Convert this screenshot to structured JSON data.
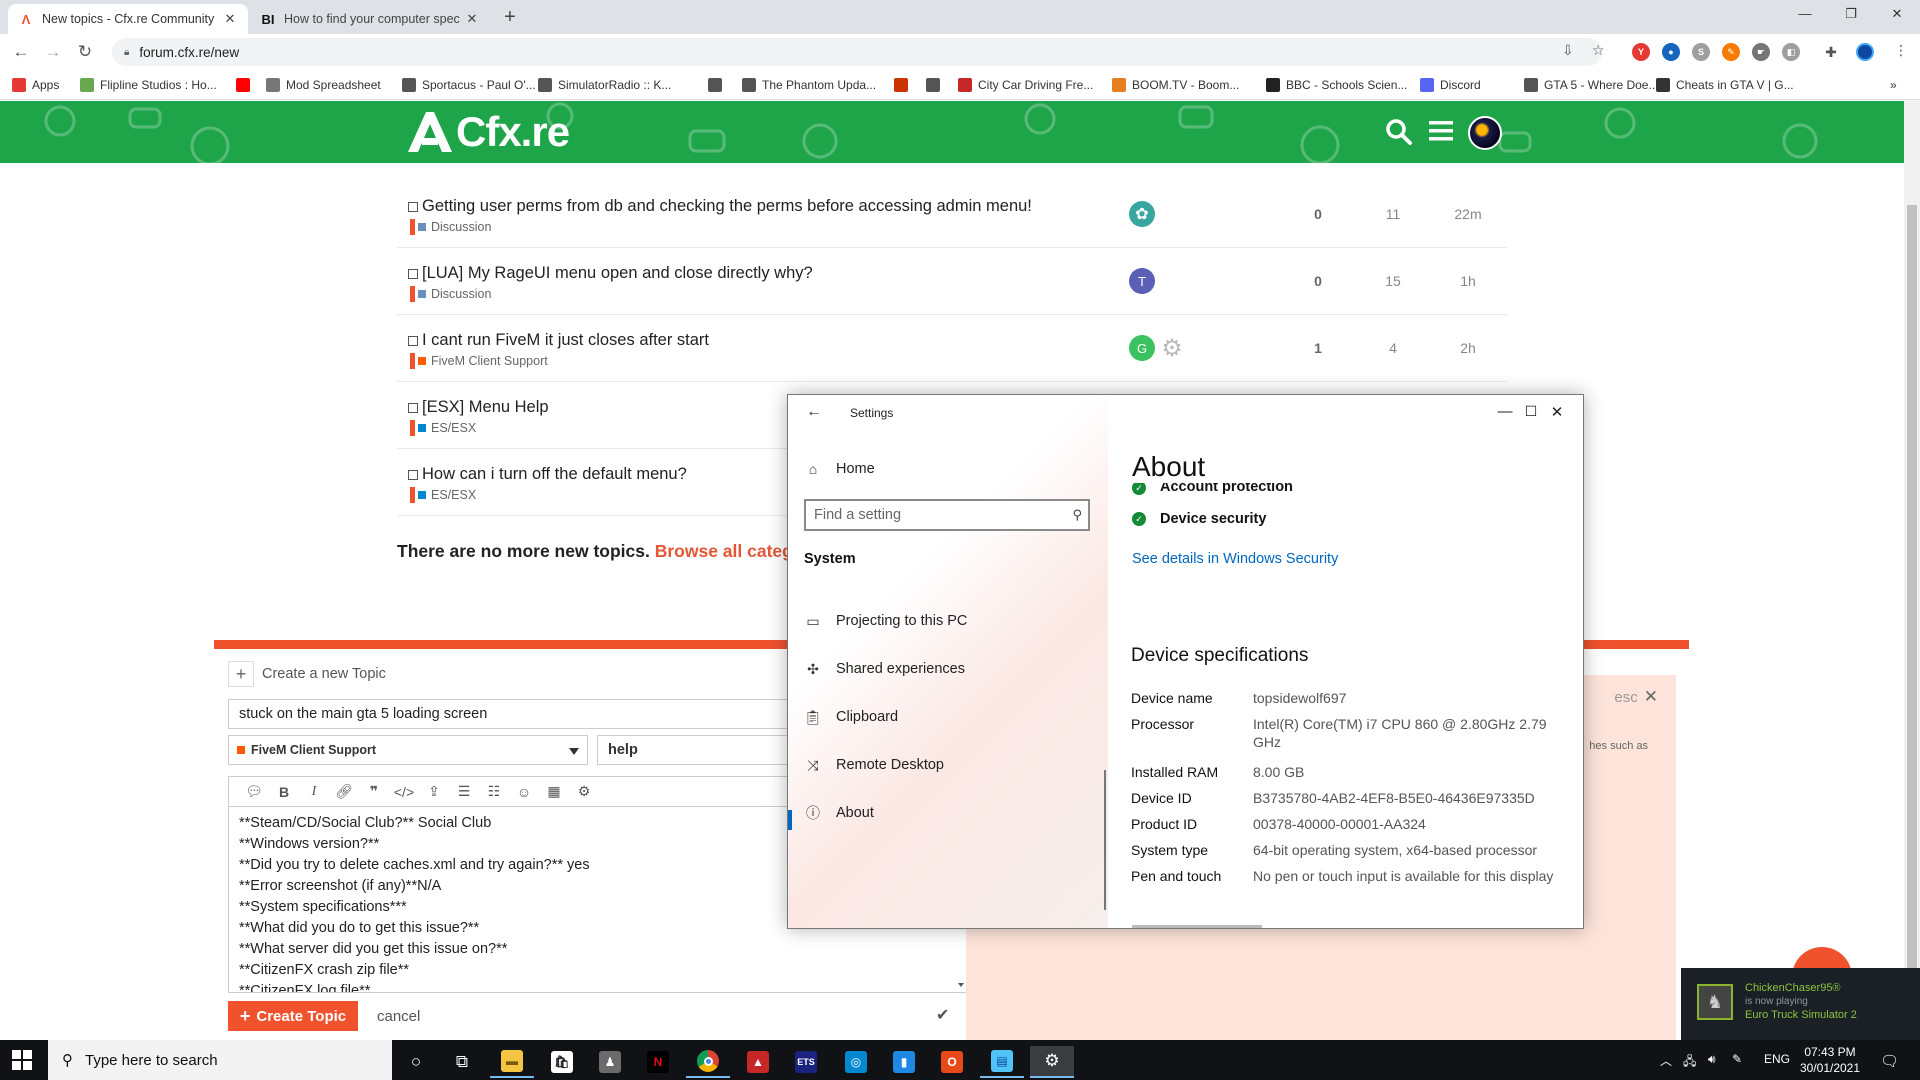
{
  "browser": {
    "tabs": [
      {
        "title": "New topics - Cfx.re Community",
        "favicon": "cfx-logo-icon"
      },
      {
        "title": "How to find your computer spec",
        "favicon_text": "BI"
      }
    ],
    "url": "forum.cfx.re/new",
    "bookmarks": [
      {
        "label": "Apps",
        "icon": "apps-grid-icon",
        "color": "#e53935"
      },
      {
        "label": "Flipline Studios : Ho...",
        "color": "#6aa84f"
      },
      {
        "label": "",
        "icon": "youtube-icon",
        "color": "#ff0000"
      },
      {
        "label": "Mod Spreadsheet",
        "color": "#777777"
      },
      {
        "label": "Sportacus - Paul O'...",
        "color": "#555555"
      },
      {
        "label": "SimulatorRadio :: K...",
        "color": "#555555"
      },
      {
        "label": "",
        "color": "#555555"
      },
      {
        "label": "The Phantom Upda...",
        "color": "#555555"
      },
      {
        "label": "",
        "color": "#cc3300"
      },
      {
        "label": "",
        "color": "#555555"
      },
      {
        "label": "City Car Driving Fre...",
        "color": "#c62828"
      },
      {
        "label": "BOOM.TV - Boom...",
        "color": "#e67e22"
      },
      {
        "label": "BBC - Schools Scien...",
        "color": "#222222"
      },
      {
        "label": "Discord",
        "color": "#5865f2"
      },
      {
        "label": "GTA 5 - Where Doe...",
        "color": "#555555"
      },
      {
        "label": "Cheats in GTA V | G...",
        "color": "#333333"
      }
    ]
  },
  "forum": {
    "topics": [
      {
        "title": "Getting user perms from db and checking the perms before accessing admin menu!",
        "category": "Discussion",
        "cat_color": "#6c8ebf",
        "cat_bar": "#f0522e",
        "poster_letter": "",
        "poster_color": "#3aa6a0",
        "replies": "0",
        "views": "11",
        "activity": "22m",
        "extra_poster": false
      },
      {
        "title": "[LUA] My RageUI menu open and close directly why?",
        "category": "Discussion",
        "cat_color": "#6c8ebf",
        "cat_bar": "#f0522e",
        "poster_letter": "T",
        "poster_color": "#5b5fb5",
        "replies": "0",
        "views": "15",
        "activity": "1h",
        "extra_poster": false
      },
      {
        "title": "I cant run FiveM it just closes after start",
        "category": "FiveM Client Support",
        "cat_color": "#ff5c00",
        "cat_bar": "#f0522e",
        "poster_letter": "G",
        "poster_color": "#3bc160",
        "replies": "1",
        "views": "4",
        "activity": "2h",
        "extra_poster": true
      },
      {
        "title": "[ESX] Menu Help",
        "category": "ES/ESX",
        "cat_color": "#0088cc",
        "cat_bar": "#f0522e",
        "poster_letter": "",
        "poster_color": "",
        "replies": "",
        "views": "",
        "activity": "",
        "extra_poster": false
      },
      {
        "title": "How can i turn off the default menu?",
        "category": "ES/ESX",
        "cat_color": "#0088cc",
        "cat_bar": "#f0522e",
        "poster_letter": "",
        "poster_color": "",
        "replies": "",
        "views": "",
        "activity": "",
        "extra_poster": false
      }
    ],
    "no_more_text": "There are no more new topics. ",
    "browse_link": "Browse all categ"
  },
  "composer": {
    "action_label": "Create a new Topic",
    "title_value": "stuck on the main gta 5 loading screen",
    "category": "FiveM Client Support",
    "tag_value": "help",
    "body_lines": [
      "**Steam/CD/Social Club?** Social Club",
      "**Windows version?**",
      "**Did you try to delete caches.xml and try again?** yes",
      "**Error screenshot (if any)**N/A",
      "**System specifications***",
      "**What did you do to get this issue?**",
      "**What server did you get this issue on?**",
      "**CitizenFX crash zip file**",
      "**CitizenFX.log file**"
    ],
    "create_label": "Create Topic",
    "cancel_label": "cancel",
    "esc_label": "esc",
    "preview_peek": "hes such as"
  },
  "settings": {
    "window_title": "Settings",
    "home_label": "Home",
    "search_placeholder": "Find a setting",
    "group_label": "System",
    "nav": [
      {
        "label": "Projecting to this PC",
        "icon": "projector-icon"
      },
      {
        "label": "Shared experiences",
        "icon": "shared-experiences-icon"
      },
      {
        "label": "Clipboard",
        "icon": "clipboard-icon"
      },
      {
        "label": "Remote Desktop",
        "icon": "remote-desktop-icon"
      },
      {
        "label": "About",
        "icon": "info-icon"
      }
    ],
    "heading": "About",
    "security_items": [
      "Account protection",
      "Device security"
    ],
    "see_details": "See details in Windows Security",
    "spec_heading": "Device specifications",
    "specs": [
      {
        "key": "Device name",
        "value": "topsidewolf697"
      },
      {
        "key": "Processor",
        "value": "Intel(R) Core(TM) i7 CPU        860  @ 2.80GHz   2.79 GHz"
      },
      {
        "key": "Installed RAM",
        "value": "8.00 GB"
      },
      {
        "key": "Device ID",
        "value": "B3735780-4AB2-4EF8-B5E0-46436E97335D"
      },
      {
        "key": "Product ID",
        "value": "00378-40000-00001-AA324"
      },
      {
        "key": "System type",
        "value": "64-bit operating system, x64-based processor"
      },
      {
        "key": "Pen and touch",
        "value": "No pen or touch input is available for this display"
      }
    ]
  },
  "steam": {
    "user": "ChickenChaser95®",
    "status": "is now playing",
    "game": "Euro Truck Simulator 2"
  },
  "taskbar": {
    "search_placeholder": "Type here to search",
    "lang": "ENG",
    "time": "07:43 PM",
    "date": "30/01/2021"
  },
  "colors": {
    "cfx_green": "#1ea54a",
    "composer_orange": "#f0522e",
    "link_blue": "#0067c0"
  }
}
